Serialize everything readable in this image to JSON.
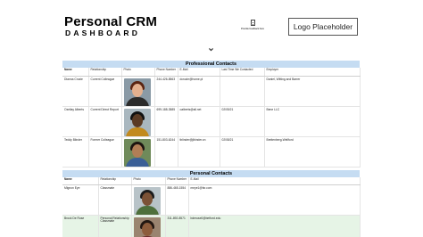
{
  "header": {
    "title": "Personal CRM",
    "subtitle": "DASHBOARD",
    "feedback_label": "Provide feedback here",
    "logo_placeholder": "Logo Placeholder"
  },
  "professional": {
    "heading": "Professional Contacts",
    "columns": [
      "Name",
      "Relationship",
      "Photo",
      "Phone Number",
      "E-Mail",
      "Last Time We Contacted",
      "Employer"
    ],
    "rows": [
      {
        "name": "Dianna Crozie",
        "relationship": "Current Colleague",
        "phone": "244-426-8563",
        "email": "dcrozie@home.pl",
        "last_contacted": "",
        "employer": "Daniel, Witting and Barrer"
      },
      {
        "name": "Ozellay Alberts",
        "relationship": "Current Direct Report",
        "phone": "699-188-3585",
        "email": "oalberts@all.net",
        "last_contacted": "02/05/21",
        "employer": "Bene LLC"
      },
      {
        "name": "Teddy Blinder",
        "relationship": "Former Colleague",
        "phone": "151-803-6244",
        "email": "tblinder@jlbinder.cn",
        "last_contacted": "02/08/21",
        "employer": "Breitenberg-Wellford"
      }
    ]
  },
  "personal": {
    "heading": "Personal Contacts",
    "columns": [
      "Name",
      "Relationship",
      "Photo",
      "Phone Number",
      "E-Mail"
    ],
    "rows": [
      {
        "name": "Mignon Eye",
        "relationship": "Classmate",
        "phone": "886-465-1554",
        "email": "meye1@fsr.com"
      },
      {
        "name": "Brock De Ruse",
        "relationship": "Personal Relationship Classmate",
        "phone": "311-892-8571",
        "email": "bderuse0@betford.edu"
      }
    ]
  },
  "photo_colors": {
    "p1": {
      "bg": "#8a9aa6",
      "hair": "#5a2412",
      "face": "#e3b08f",
      "body": "#2b2b2b"
    },
    "p2": {
      "bg": "#a9b7bf",
      "hair": "#111111",
      "face": "#5a3a24",
      "body": "#c28a1e"
    },
    "p3": {
      "bg": "#6f8a5a",
      "hair": "#1c1410",
      "face": "#b17e56",
      "body": "#3b5f96"
    },
    "p4": {
      "bg": "#b8c3c8",
      "hair": "#1b1b1b",
      "face": "#7b5236",
      "body": "#4d6f3b"
    },
    "p5": {
      "bg": "#9a8470",
      "hair": "#221712",
      "face": "#8c5c3c",
      "body": "#6b2a2a"
    }
  }
}
